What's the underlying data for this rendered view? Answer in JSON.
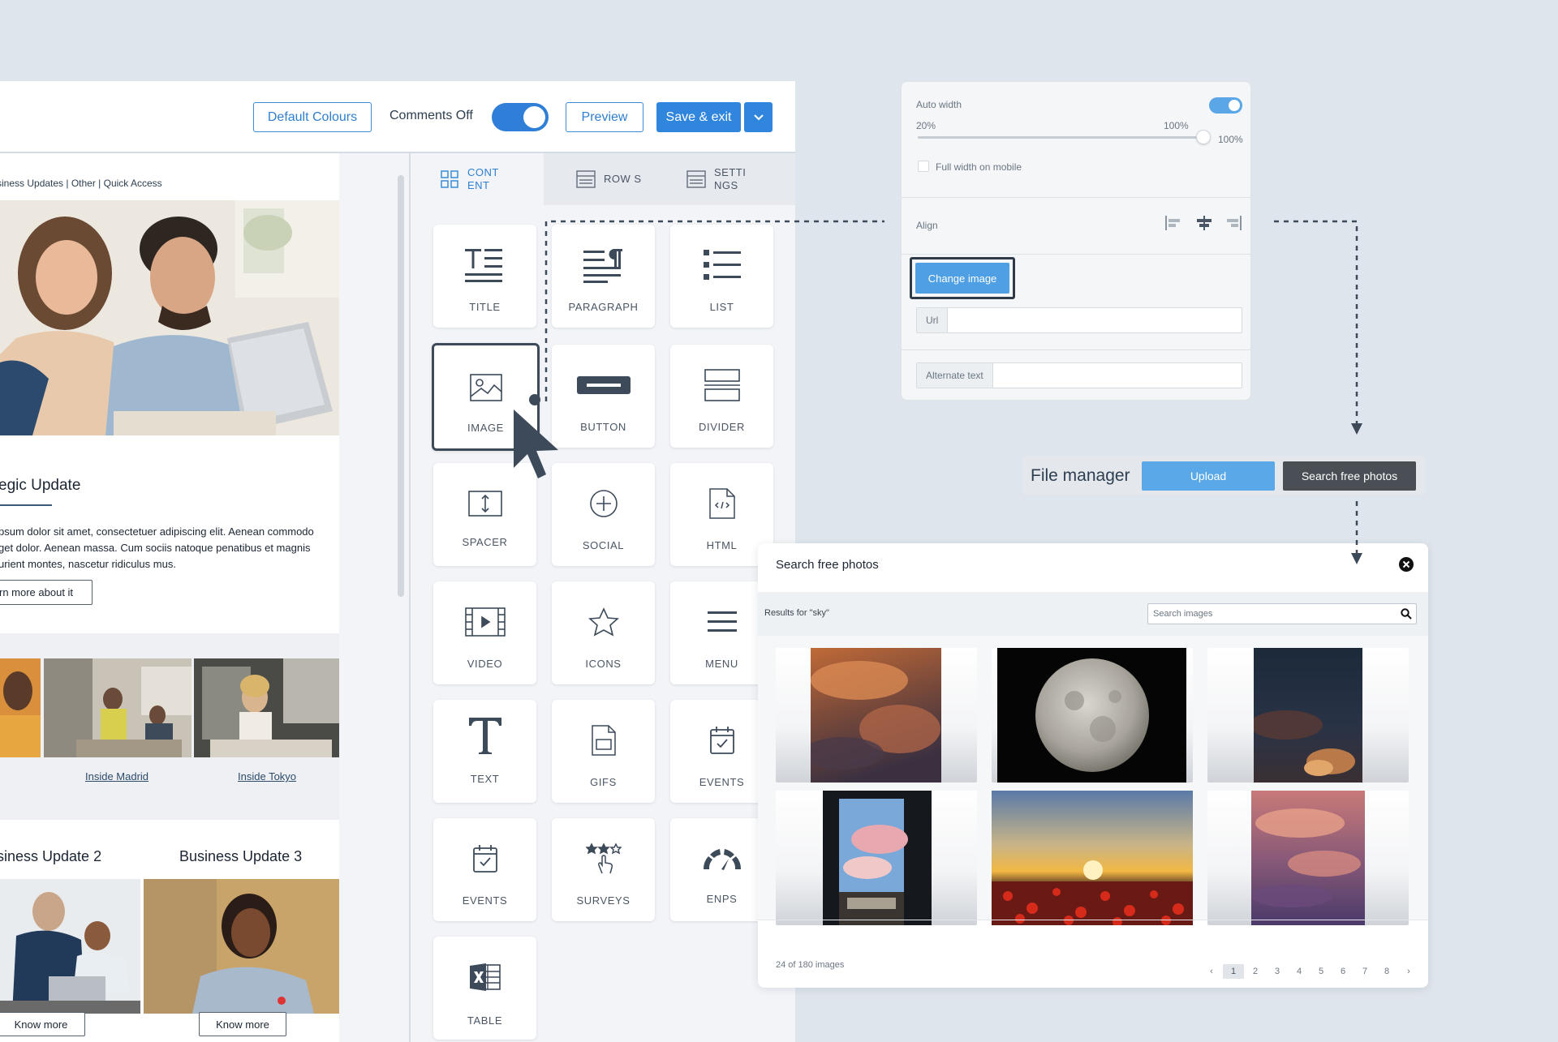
{
  "toolbar": {
    "default_colours_label": "Default Colours",
    "comments_label": "Comments Off",
    "preview_label": "Preview",
    "save_exit_label": "Save & exit"
  },
  "email": {
    "nav_links": "siness Updates | Other | Quick Access",
    "heading": "egic Update",
    "paragraph_lines": [
      "psum dolor sit amet, consectetuer adipiscing elit. Aenean commodo",
      "get dolor. Aenean massa. Cum sociis natoque penatibus et magnis",
      "urient montes, nascetur ridiculus mus."
    ],
    "read_more_label": "rn more about it",
    "captions": [
      "Inside Madrid",
      "Inside Tokyo"
    ],
    "updates": [
      "siness Update 2",
      "Business Update 3"
    ],
    "know_more_label": "Know more"
  },
  "content_panel": {
    "tabs": [
      {
        "label": "CONT ENT",
        "icon": "grid-icon"
      },
      {
        "label": "ROW S",
        "icon": "rows-icon"
      },
      {
        "label": "SETTI NGS",
        "icon": "settings-list-icon"
      }
    ],
    "blocks": [
      {
        "label": "TITLE",
        "icon": "title-icon"
      },
      {
        "label": "PARAGRAPH",
        "icon": "paragraph-icon"
      },
      {
        "label": "LIST",
        "icon": "list-icon"
      },
      {
        "label": "IMAGE",
        "icon": "image-icon"
      },
      {
        "label": "BUTTON",
        "icon": "button-icon"
      },
      {
        "label": "DIVIDER",
        "icon": "divider-icon"
      },
      {
        "label": "SPACER",
        "icon": "spacer-icon"
      },
      {
        "label": "SOCIAL",
        "icon": "social-icon"
      },
      {
        "label": "HTML",
        "icon": "html-icon"
      },
      {
        "label": "VIDEO",
        "icon": "video-icon"
      },
      {
        "label": "ICONS",
        "icon": "star-icon"
      },
      {
        "label": "MENU",
        "icon": "menu-icon"
      },
      {
        "label": "TEXT",
        "icon": "text-icon"
      },
      {
        "label": "GIFS",
        "icon": "gif-icon"
      },
      {
        "label": "EVENTS",
        "icon": "calendar-icon"
      },
      {
        "label": "EVENTS",
        "icon": "calendar-icon"
      },
      {
        "label": "SURVEYS",
        "icon": "surveys-icon"
      },
      {
        "label": "ENPS",
        "icon": "gauge-icon"
      },
      {
        "label": "TABLE",
        "icon": "excel-icon"
      }
    ]
  },
  "image_settings": {
    "auto_width_label": "Auto width",
    "auto_width_on": true,
    "slider_min": "20%",
    "slider_max": "100%",
    "slider_value": "100%",
    "slider_fraction": 1.0,
    "full_width_mobile_label": "Full width on mobile",
    "align_label": "Align",
    "change_image_label": "Change image",
    "url_label": "Url",
    "url_value": "",
    "alt_text_label": "Alternate text",
    "alt_text_value": ""
  },
  "file_manager": {
    "label": "File manager",
    "upload_label": "Upload",
    "search_label": "Search free photos"
  },
  "search_photos": {
    "title": "Search free photos",
    "results_label": "Results for \"sky\"",
    "search_placeholder": "Search images",
    "count_label": "24 of 180 images",
    "pages": [
      "1",
      "2",
      "3",
      "4",
      "5",
      "6",
      "7",
      "8"
    ],
    "current_page": "1",
    "prev_symbol": "‹",
    "next_symbol": "›"
  },
  "colors": {
    "accent": "#2f86dc",
    "accent_light": "#5aa8e8",
    "dark_button": "#4a4f56",
    "background": "#dfe5ec"
  }
}
